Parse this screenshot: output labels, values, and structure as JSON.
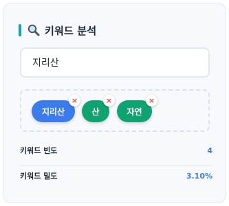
{
  "panel": {
    "title": "키워드 분석",
    "accent_color": "#14a3b8",
    "header_icon": "search-icon"
  },
  "keyword_input": {
    "value": "지리산"
  },
  "tags": [
    {
      "label": "지리산",
      "color": "#3b7bea",
      "remove_label": "×"
    },
    {
      "label": "산",
      "color": "#10a36f",
      "remove_label": "×"
    },
    {
      "label": "자연",
      "color": "#10a36f",
      "remove_label": "×"
    }
  ],
  "stats": {
    "frequency_label": "키워드 빈도",
    "frequency_value": "4",
    "density_label": "키워드 밀도",
    "density_value": "3.10%",
    "value_color": "#3b7ddd"
  }
}
